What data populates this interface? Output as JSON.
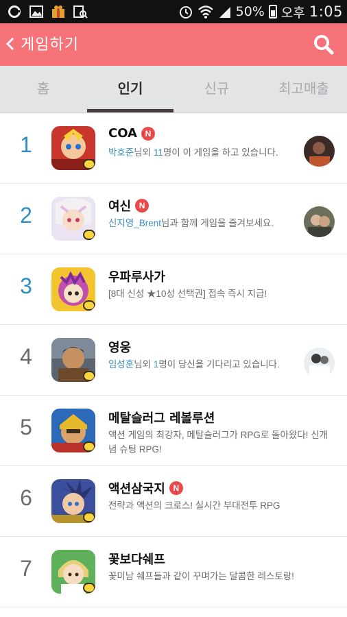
{
  "status_bar": {
    "battery": "50%",
    "ampm": "오후",
    "time": "1:05",
    "icons": [
      "notification-icon",
      "gallery-icon",
      "gift-icon",
      "app-search-icon",
      "alarm-icon",
      "wifi-icon",
      "signal-icon",
      "battery-icon"
    ]
  },
  "header": {
    "title": "게임하기",
    "back_icon": "chevron-left-icon",
    "search_icon": "search-icon",
    "color": "#f7737a"
  },
  "tabs": [
    {
      "label": "홈",
      "active": false
    },
    {
      "label": "인기",
      "active": true
    },
    {
      "label": "신규",
      "active": false
    },
    {
      "label": "최고매출",
      "active": false
    }
  ],
  "games": [
    {
      "rank": "1",
      "name": "COA",
      "new": true,
      "new_label": "N",
      "desc": {
        "hl1": "박호준",
        "t1": "님외 ",
        "hl2": "11",
        "t2": "명이 이 게임을 하고 있습니다."
      },
      "has_avatar": true
    },
    {
      "rank": "2",
      "name": "여신",
      "new": true,
      "new_label": "N",
      "desc": {
        "hl1": "신지영_Brent",
        "t1": "님과 함께 게임을 즐겨보세요.",
        "hl2": "",
        "t2": ""
      },
      "has_avatar": true
    },
    {
      "rank": "3",
      "name": "우파루사가",
      "new": false,
      "new_label": "",
      "desc": {
        "hl1": "",
        "t1": "[8대 신성 ★10성 선택권]   접속 즉시 지급!",
        "hl2": "",
        "t2": ""
      },
      "has_avatar": false
    },
    {
      "rank": "4",
      "name": "영웅",
      "new": false,
      "new_label": "",
      "desc": {
        "hl1": "임성훈",
        "t1": "님외 ",
        "hl2": "1",
        "t2": "명이 당신을 기다리고 있습니다."
      },
      "has_avatar": true
    },
    {
      "rank": "5",
      "name": "메탈슬러그 레볼루션",
      "new": false,
      "new_label": "",
      "desc": {
        "hl1": "",
        "t1": "액션 게임의 최강자, 메탈슬러그가 RPG로 돌아왔다! 신개념 슈팅 RPG!",
        "hl2": "",
        "t2": ""
      },
      "has_avatar": false
    },
    {
      "rank": "6",
      "name": "액션삼국지",
      "new": true,
      "new_label": "N",
      "desc": {
        "hl1": "",
        "t1": "전략과 액션의 크로스! 실시간 부대전투 RPG",
        "hl2": "",
        "t2": ""
      },
      "has_avatar": false
    },
    {
      "rank": "7",
      "name": "꽃보다쉐프",
      "new": false,
      "new_label": "",
      "desc": {
        "hl1": "",
        "t1": "꽃미남 쉐프들과 같이 꾸며가는 달콤한 레스토랑!",
        "hl2": "",
        "t2": ""
      },
      "has_avatar": false
    }
  ],
  "colors": {
    "rank_top": "#2e8fc0",
    "rank_rest": "#6b6b6b",
    "highlight": "#3d8fc2",
    "new_badge": "#e94a49"
  }
}
